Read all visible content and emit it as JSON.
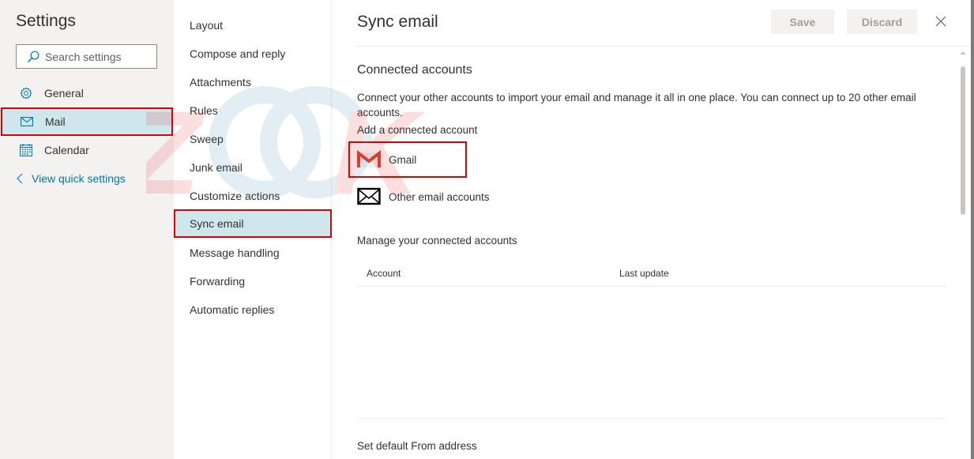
{
  "left": {
    "title": "Settings",
    "search_placeholder": "Search settings",
    "nav": [
      {
        "label": "General",
        "icon": "gear-icon",
        "selected": false
      },
      {
        "label": "Mail",
        "icon": "mail-icon",
        "selected": true
      },
      {
        "label": "Calendar",
        "icon": "calendar-icon",
        "selected": false
      }
    ],
    "back_link": "View quick settings"
  },
  "middle": {
    "items": [
      {
        "label": "Layout"
      },
      {
        "label": "Compose and reply"
      },
      {
        "label": "Attachments"
      },
      {
        "label": "Rules"
      },
      {
        "label": "Sweep"
      },
      {
        "label": "Junk email"
      },
      {
        "label": "Customize actions"
      },
      {
        "label": "Sync email",
        "selected": true
      },
      {
        "label": "Message handling"
      },
      {
        "label": "Forwarding"
      },
      {
        "label": "Automatic replies"
      }
    ]
  },
  "main": {
    "title": "Sync email",
    "save_label": "Save",
    "discard_label": "Discard",
    "section_title": "Connected accounts",
    "description": "Connect your other accounts to import your email and manage it all in one place. You can connect up to 20 other email accounts.",
    "add_label": "Add a connected account",
    "options": {
      "gmail": "Gmail",
      "other": "Other email accounts"
    },
    "manage_title": "Manage your connected accounts",
    "table": {
      "columns": [
        "Account",
        "Last update"
      ],
      "rows": []
    },
    "default_from": "Set default From address"
  },
  "colors": {
    "accent": "#0078a4",
    "selected_bg": "#cfe6ed",
    "highlight_border": "#e00000",
    "gmail_red": "#d44638"
  }
}
